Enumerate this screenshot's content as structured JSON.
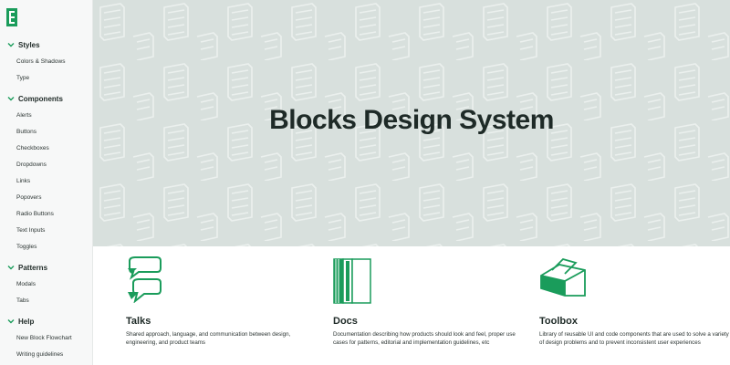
{
  "sidebar": {
    "sections": [
      {
        "label": "Styles",
        "items": [
          "Colors & Shadows",
          "Type"
        ]
      },
      {
        "label": "Components",
        "items": [
          "Alerts",
          "Buttons",
          "Checkboxes",
          "Dropdowns",
          "Links",
          "Popovers",
          "Radio Buttons",
          "Text Inputs",
          "Toggles"
        ]
      },
      {
        "label": "Patterns",
        "items": [
          "Modals",
          "Tabs"
        ]
      },
      {
        "label": "Help",
        "items": [
          "New Block Flowchart",
          "Writing guidelines"
        ]
      }
    ]
  },
  "hero": {
    "title": "Blocks Design System"
  },
  "cards": [
    {
      "title": "Talks",
      "icon": "speech-bubbles-icon",
      "description": "Shared approach, language, and communication between design, engineering, and product teams"
    },
    {
      "title": "Docs",
      "icon": "books-icon",
      "description": "Documentation describing how products should look and feel, proper use cases for patterns, editorial and implementation guidelines, etc"
    },
    {
      "title": "Toolbox",
      "icon": "toolbox-icon",
      "description": "Library of reusable UI and code components that are used to solve a variety of design problems and to prevent inconsistent user experiences"
    }
  ],
  "colors": {
    "brand_green": "#1a9c5b",
    "hero_bg": "#d8e0dd",
    "text_dark": "#1e2a27"
  }
}
